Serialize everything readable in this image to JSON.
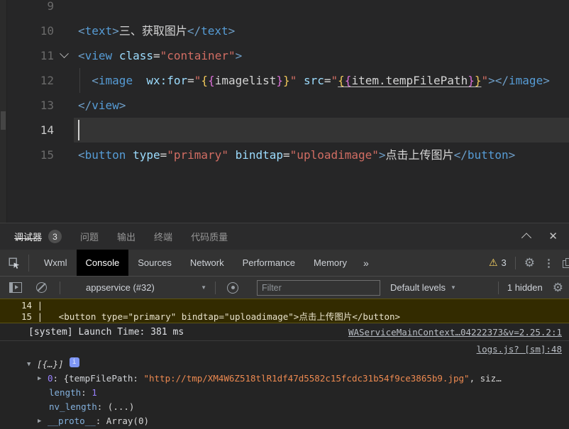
{
  "icons": {
    "chevron_up": "collapse-panel",
    "close": "✕",
    "more_tabs": "»",
    "gear": "⚙",
    "kebab": "⋮",
    "warning": "⚠",
    "dropdown": "▼",
    "caret_down": "▼",
    "caret_right": "▶"
  },
  "colors": {
    "editor_bg": "#262627",
    "console_bg": "#242424",
    "warning_bg": "#332b00",
    "tag": "#569cd6",
    "attr": "#9cdcfe",
    "string": "#d16d63",
    "brace_gold": "#f0c85a",
    "brace_purple": "#da70d6",
    "console_string": "#ec8950",
    "console_number": "#9980ff"
  },
  "editor": {
    "lines": [
      {
        "num": "9",
        "tokens": []
      },
      {
        "num": "10",
        "tokens": [
          [
            "bracket",
            "<"
          ],
          [
            "tag",
            "text"
          ],
          [
            "bracket",
            ">"
          ],
          [
            "plain",
            "三、获取图片"
          ],
          [
            "bracket",
            "</"
          ],
          [
            "tag",
            "text"
          ],
          [
            "bracket",
            ">"
          ]
        ]
      },
      {
        "num": "11",
        "fold": true,
        "tokens": [
          [
            "bracket",
            "<"
          ],
          [
            "tag",
            "view"
          ],
          [
            "plain",
            " "
          ],
          [
            "attr",
            "class"
          ],
          [
            "plain",
            "="
          ],
          [
            "str",
            "\"container\""
          ],
          [
            "bracket",
            ">"
          ]
        ]
      },
      {
        "num": "12",
        "guide": true,
        "tokens": [
          [
            "plain",
            "  "
          ],
          [
            "bracket",
            "<"
          ],
          [
            "tag",
            "image"
          ],
          [
            "plain",
            "  "
          ],
          [
            "attr",
            "wx:for"
          ],
          [
            "plain",
            "="
          ],
          [
            "str",
            "\""
          ],
          [
            "b1",
            "{"
          ],
          [
            "b2",
            "{"
          ],
          [
            "plain",
            "imagelist"
          ],
          [
            "b2",
            "}"
          ],
          [
            "b1",
            "}"
          ],
          [
            "str",
            "\""
          ],
          [
            "plain",
            " "
          ],
          [
            "attr",
            "src"
          ],
          [
            "plain",
            "="
          ],
          [
            "str",
            "\""
          ],
          [
            "b1 u",
            "{"
          ],
          [
            "b2 u",
            "{"
          ],
          [
            "plain u",
            "item.tempFilePath"
          ],
          [
            "b2 u",
            "}"
          ],
          [
            "b1 u",
            "}"
          ],
          [
            "str",
            "\""
          ],
          [
            "bracket",
            ">"
          ],
          [
            "bracket",
            "</"
          ],
          [
            "tag",
            "image"
          ],
          [
            "bracket",
            ">"
          ]
        ]
      },
      {
        "num": "13",
        "tokens": [
          [
            "bracket",
            "</"
          ],
          [
            "tag",
            "view"
          ],
          [
            "bracket",
            ">"
          ]
        ]
      },
      {
        "num": "14",
        "active": true,
        "tokens": []
      },
      {
        "num": "15",
        "tokens": [
          [
            "bracket",
            "<"
          ],
          [
            "tag",
            "button"
          ],
          [
            "plain",
            " "
          ],
          [
            "attr",
            "type"
          ],
          [
            "plain",
            "="
          ],
          [
            "str",
            "\"primary\""
          ],
          [
            "plain",
            " "
          ],
          [
            "attr",
            "bindtap"
          ],
          [
            "plain",
            "="
          ],
          [
            "str",
            "\"uploadimage\""
          ],
          [
            "bracket",
            ">"
          ],
          [
            "plain",
            "点击上传图片"
          ],
          [
            "bracket",
            "</"
          ],
          [
            "tag",
            "button"
          ],
          [
            "bracket",
            ">"
          ]
        ]
      }
    ]
  },
  "panel": {
    "tabs": [
      {
        "label": "调试器",
        "badge": "3",
        "active": true
      },
      {
        "label": "问题"
      },
      {
        "label": "输出"
      },
      {
        "label": "终端"
      },
      {
        "label": "代码质量"
      }
    ]
  },
  "devtools": {
    "tabs": [
      {
        "label": "Wxml"
      },
      {
        "label": "Console",
        "active": true
      },
      {
        "label": "Sources"
      },
      {
        "label": "Network"
      },
      {
        "label": "Performance"
      },
      {
        "label": "Memory"
      }
    ],
    "more": "»",
    "warning_count": "3"
  },
  "toolbar": {
    "context": "appservice (#32)",
    "filter_placeholder": "Filter",
    "levels": "Default levels",
    "hidden": "1 hidden"
  },
  "console": {
    "warning": {
      "lines": [
        "14 | ",
        "15 |   <button type=\"primary\" bindtap=\"uploadimage\">点击上传图片</button>"
      ]
    },
    "system": {
      "text": "[system] Launch Time: 381 ms",
      "link": "WAServiceMainContext…04222373&v=2.25.2:1"
    },
    "log": {
      "link": "logs.js? [sm]:48",
      "tree": [
        {
          "level": 0,
          "caret": "▼",
          "badge": "i",
          "tokens": [
            [
              "preview",
              "[{…}]"
            ]
          ]
        },
        {
          "level": 1,
          "caret": "▶",
          "tokens": [
            [
              "num",
              "0"
            ],
            [
              "plain",
              ": {"
            ],
            [
              "pkey",
              "tempFilePath"
            ],
            [
              "plain",
              ": "
            ],
            [
              "str",
              "\"http://tmp/XM4W6Z518tlR1df47d5582c15fcdc31b54f9ce3865b9.jpg\""
            ],
            [
              "plain",
              ", siz…"
            ]
          ]
        },
        {
          "level": 2,
          "tokens": [
            [
              "key",
              "length"
            ],
            [
              "plain",
              ": "
            ],
            [
              "num",
              "1"
            ]
          ]
        },
        {
          "level": 2,
          "tokens": [
            [
              "key",
              "nv_length"
            ],
            [
              "plain",
              ": "
            ],
            [
              "dim",
              "(...)"
            ]
          ]
        },
        {
          "level": 1,
          "caret": "▶",
          "tokens": [
            [
              "key",
              "__proto__"
            ],
            [
              "plain",
              ": "
            ],
            [
              "dim",
              "Array(0)"
            ]
          ]
        }
      ]
    }
  }
}
